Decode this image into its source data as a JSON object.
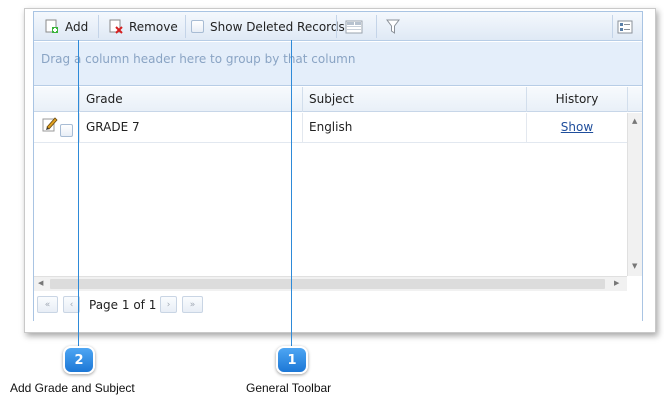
{
  "toolbar": {
    "add_label": "Add",
    "remove_label": "Remove",
    "show_deleted_label": "Show Deleted Records"
  },
  "group_panel": {
    "hint": "Drag a column header here to group by that column"
  },
  "table": {
    "columns": [
      "Grade",
      "Subject",
      "History"
    ],
    "rows": [
      {
        "grade": "GRADE 7",
        "subject": "English",
        "history": "Show"
      }
    ]
  },
  "pager": {
    "page_text": "Page 1 of 1"
  },
  "callouts": [
    {
      "number": "2",
      "caption": "Add Grade and Subject"
    },
    {
      "number": "1",
      "caption": "General Toolbar"
    }
  ],
  "colors": {
    "accent": "#1c77d6",
    "link": "#1f4e9c",
    "group_panel_bg": "#e4eefa"
  },
  "icons": [
    "add-icon",
    "remove-icon",
    "column-chooser-icon",
    "filter-icon",
    "layout-icon",
    "edit-icon"
  ]
}
